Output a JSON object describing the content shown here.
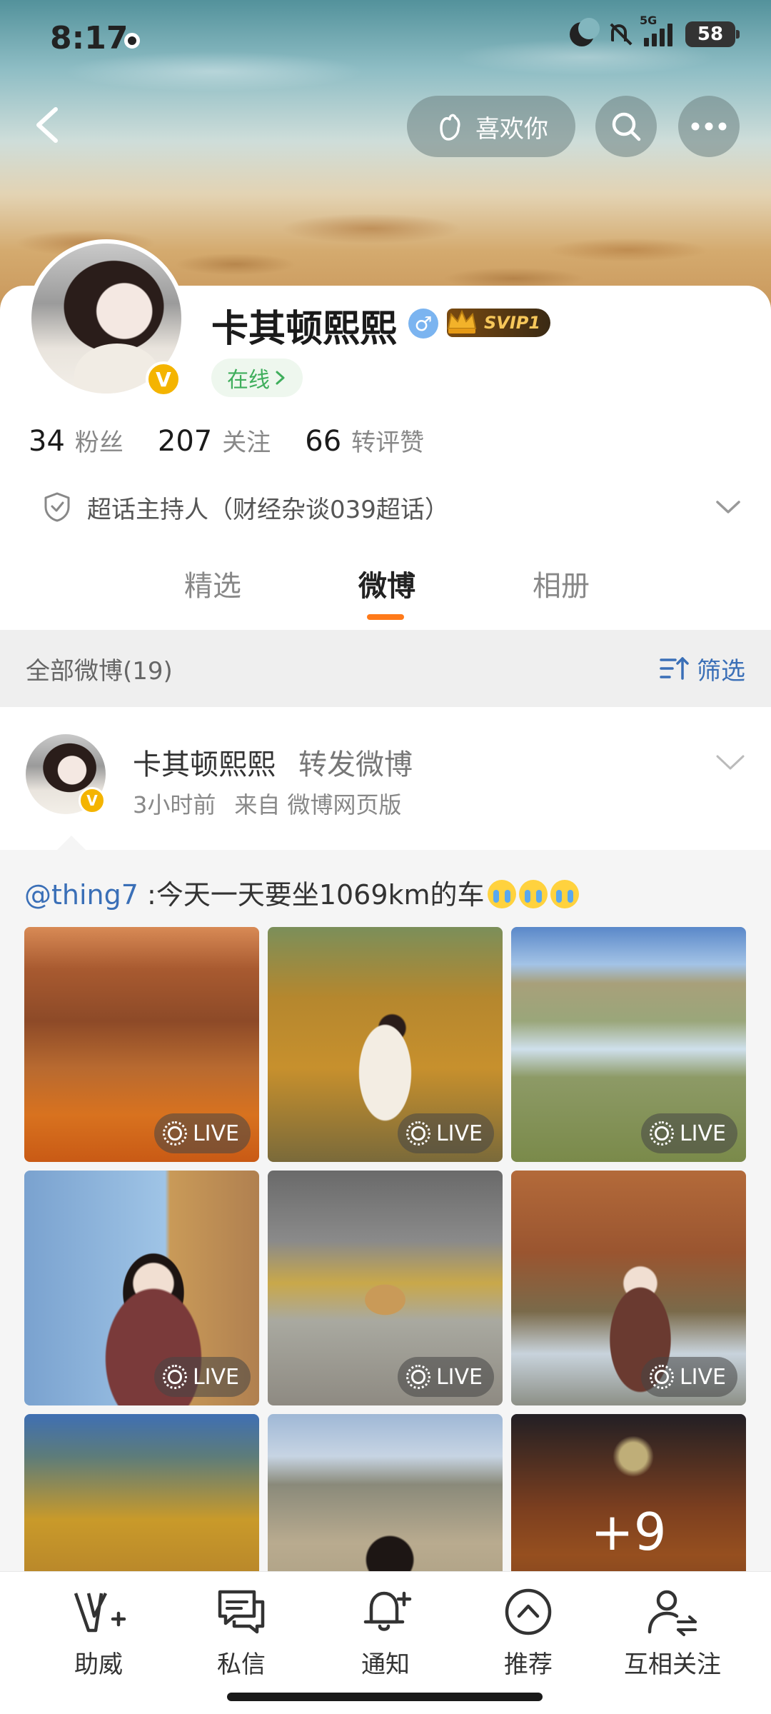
{
  "status_bar": {
    "time": "8:17",
    "network": "5G",
    "battery": "58"
  },
  "header": {
    "like_label": "喜欢你"
  },
  "profile": {
    "name": "卡其顿熙熙",
    "gender_symbol": "♂",
    "vip_label": "SVIP1",
    "verified_symbol": "V",
    "online_label": "在线",
    "stats": [
      {
        "value": "34",
        "label": "粉丝"
      },
      {
        "value": "207",
        "label": "关注"
      },
      {
        "value": "66",
        "label": "转评赞"
      }
    ],
    "host_text": "超话主持人（财经杂谈039超话）"
  },
  "tabs": [
    {
      "label": "精选",
      "active": false
    },
    {
      "label": "微博",
      "active": true
    },
    {
      "label": "相册",
      "active": false
    }
  ],
  "list_header": {
    "count_label": "全部微博(19)",
    "filter_label": "筛选"
  },
  "post": {
    "author": "卡其顿熙熙",
    "action": "转发微博",
    "time": "3小时前",
    "source": "来自 微博网页版",
    "repost": {
      "mention": "@thing7",
      "text": " :今天一天要坐1069km的车"
    },
    "live_label": "LIVE",
    "more_count": "+9"
  },
  "bottom_bar": [
    {
      "label": "助威"
    },
    {
      "label": "私信"
    },
    {
      "label": "通知"
    },
    {
      "label": "推荐"
    },
    {
      "label": "互相关注"
    }
  ]
}
